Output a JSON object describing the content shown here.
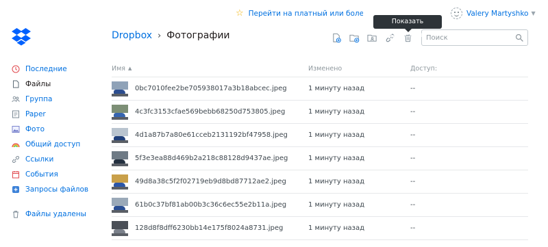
{
  "topbar": {
    "upgrade_text": "Перейти на платный или более дорогой тарифный план",
    "user_name": "Valery Martyshko",
    "tooltip": "Показать удаленные"
  },
  "header": {
    "breadcrumb_root": "Dropbox",
    "breadcrumb_sep": "›",
    "breadcrumb_current": "Фотографии",
    "search_placeholder": "Поиск"
  },
  "toolbar": {
    "icons": [
      "upload-file-icon",
      "new-folder-icon",
      "new-shared-folder-icon",
      "share-link-icon",
      "show-deleted-icon"
    ]
  },
  "sidebar": {
    "items": [
      {
        "label": "Последние",
        "icon": "clock-icon",
        "active": false
      },
      {
        "label": "Файлы",
        "icon": "file-icon",
        "active": true
      },
      {
        "label": "Группа",
        "icon": "team-icon",
        "active": false
      },
      {
        "label": "Paper",
        "icon": "paper-icon",
        "active": false
      },
      {
        "label": "Фото",
        "icon": "photo-icon",
        "active": false
      },
      {
        "label": "Общий доступ",
        "icon": "sharing-icon",
        "active": false
      },
      {
        "label": "Ссылки",
        "icon": "link-icon",
        "active": false
      },
      {
        "label": "События",
        "icon": "calendar-icon",
        "active": false
      },
      {
        "label": "Запросы файлов",
        "icon": "file-request-icon",
        "active": false
      }
    ],
    "deleted_label": "Файлы удалены"
  },
  "table": {
    "columns": {
      "name": "Имя",
      "modified": "Изменено",
      "access": "Доступ:"
    },
    "rows": [
      {
        "name": "0bc7010fee2be705938017a3b18abcec.jpeg",
        "modified": "1 минуту назад",
        "access": "--"
      },
      {
        "name": "4c3fc3153cfae569bebb68250d753805.jpeg",
        "modified": "1 минуту назад",
        "access": "--"
      },
      {
        "name": "4d1a87b7a80e61cceb2131192bf47958.jpeg",
        "modified": "1 минуту назад",
        "access": "--"
      },
      {
        "name": "5f3e3ea88d469b2a218c88128d9437ae.jpeg",
        "modified": "1 минуту назад",
        "access": "--"
      },
      {
        "name": "49d8a38c5f2f02719eb9d8bd87712ae2.jpeg",
        "modified": "1 минуту назад",
        "access": "--"
      },
      {
        "name": "61b0c37bf81ab00b3c36c6ec55e2b11a.jpeg",
        "modified": "1 минуту назад",
        "access": "--"
      },
      {
        "name": "128d8f8dff6230bb14e175f8024a8731.jpeg",
        "modified": "1 минуту назад",
        "access": "--"
      }
    ]
  },
  "colors": {
    "accent": "#0070e0",
    "brand": "#0061fe",
    "star": "#f2b200"
  }
}
